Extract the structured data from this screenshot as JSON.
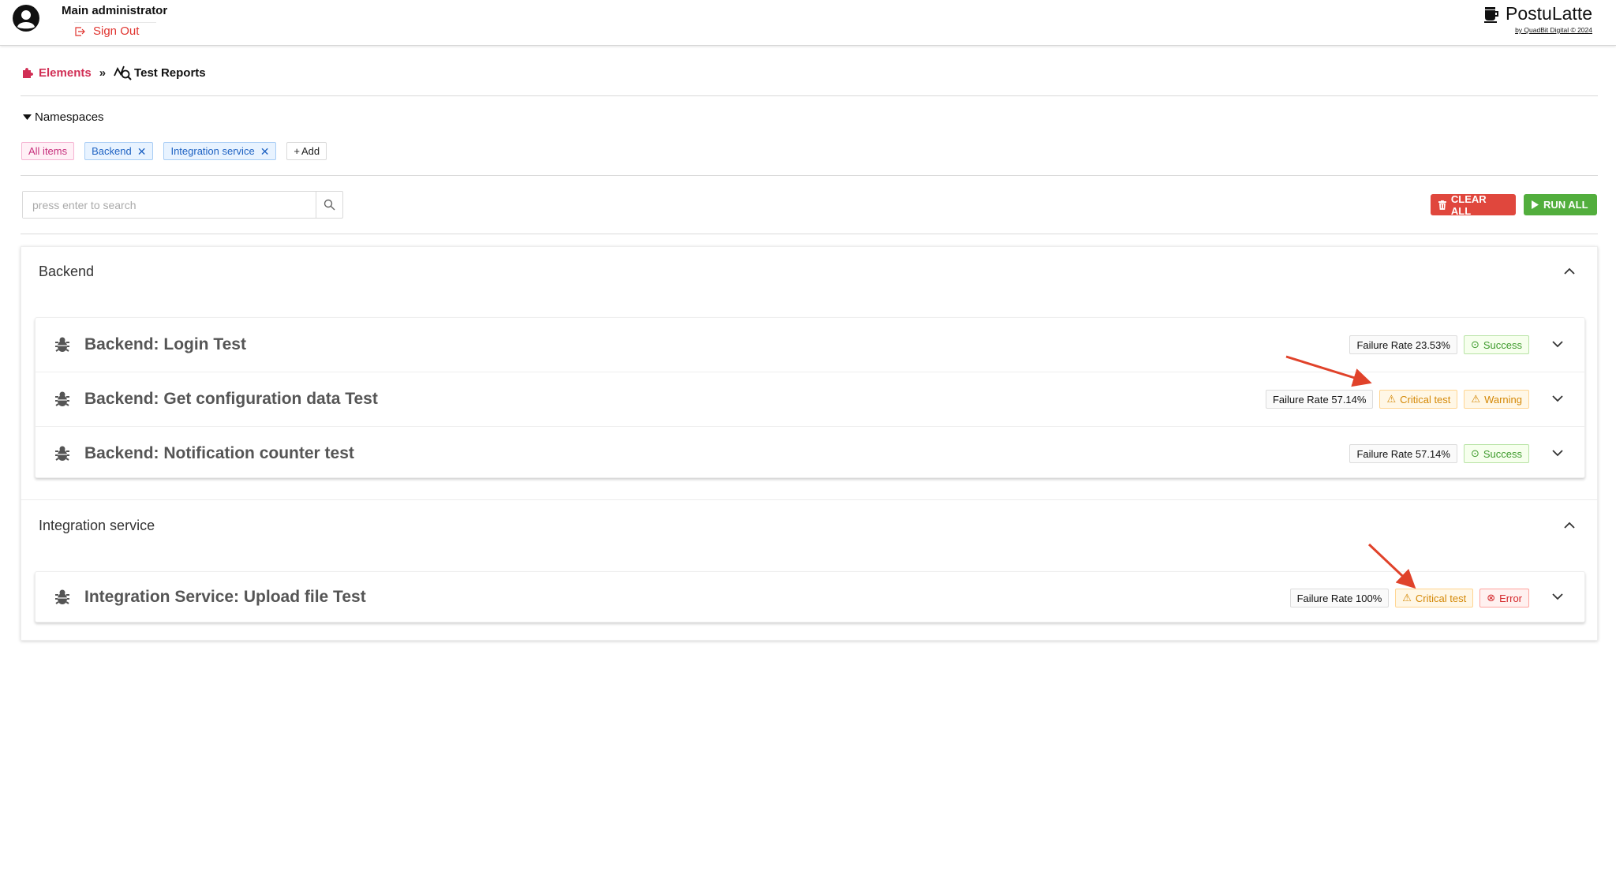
{
  "header": {
    "admin_name": "Main administrator",
    "signout_label": "Sign Out",
    "brand_title": "PostuLatte",
    "brand_sub": "by QuadBit Digital © 2024"
  },
  "breadcrumb": {
    "elements_label": "Elements",
    "separator": "»",
    "current_label": "Test Reports"
  },
  "namespaces": {
    "toggle_label": "Namespaces",
    "tags": [
      "All items",
      "Backend",
      "Integration service"
    ],
    "add_label": "Add"
  },
  "search": {
    "placeholder": "press enter to search"
  },
  "actions": {
    "clear_all": "CLEAR ALL",
    "run_all": "RUN ALL"
  },
  "sections": [
    {
      "title": "Backend",
      "tests": [
        {
          "title": "Backend: Login Test",
          "failure_rate": "Failure Rate 23.53%",
          "critical": "",
          "status": "Success"
        },
        {
          "title": "Backend: Get configuration data Test",
          "failure_rate": "Failure Rate 57.14%",
          "critical": "Critical test",
          "status": "Warning"
        },
        {
          "title": "Backend: Notification counter test",
          "failure_rate": "Failure Rate 57.14%",
          "critical": "",
          "status": "Success"
        }
      ]
    },
    {
      "title": "Integration service",
      "tests": [
        {
          "title": "Integration Service: Upload file Test",
          "failure_rate": "Failure Rate 100%",
          "critical": "Critical test",
          "status": "Error"
        }
      ]
    }
  ],
  "colors": {
    "accent_pink": "#d12f55",
    "danger": "#e0473d",
    "success": "#52ae3d",
    "annotation_arrow": "#e0422a"
  }
}
